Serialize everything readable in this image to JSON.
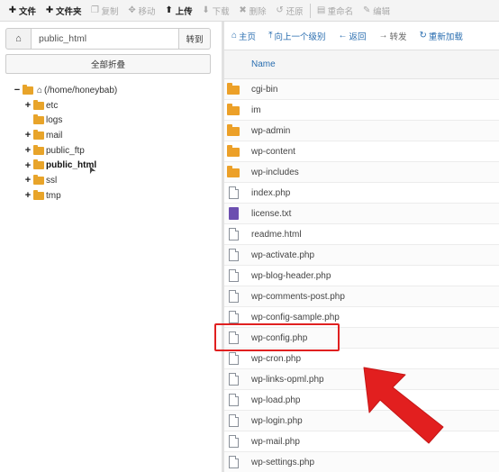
{
  "toolbar": {
    "items": [
      {
        "icon": "plus-icon",
        "glyph": "✚",
        "label": "文件",
        "enabled": true
      },
      {
        "icon": "plus-icon",
        "glyph": "✚",
        "label": "文件夹",
        "enabled": true
      },
      {
        "icon": "copy-icon",
        "glyph": "❐",
        "label": "复制",
        "enabled": false
      },
      {
        "icon": "move-icon",
        "glyph": "✥",
        "label": "移动",
        "enabled": false
      },
      {
        "icon": "upload-icon",
        "glyph": "⬆",
        "label": "上传",
        "enabled": true
      },
      {
        "icon": "download-icon",
        "glyph": "⬇",
        "label": "下载",
        "enabled": false
      },
      {
        "icon": "delete-icon",
        "glyph": "✖",
        "label": "删除",
        "enabled": false
      },
      {
        "icon": "restore-icon",
        "glyph": "↺",
        "label": "还原",
        "enabled": false
      },
      {
        "icon": "rename-icon",
        "glyph": "▤",
        "label": "重命名",
        "enabled": false
      },
      {
        "icon": "edit-icon",
        "glyph": "✎",
        "label": "编辑",
        "enabled": false
      }
    ]
  },
  "left_panel": {
    "path_value": "public_html",
    "go_label": "转到",
    "collapse_label": "全部折叠",
    "tree": {
      "root_label": "(/home/honeybab)",
      "children": [
        {
          "label": "etc",
          "expandable": true,
          "bold": false
        },
        {
          "label": "logs",
          "expandable": false,
          "bold": false
        },
        {
          "label": "mail",
          "expandable": true,
          "bold": false
        },
        {
          "label": "public_ftp",
          "expandable": true,
          "bold": false
        },
        {
          "label": "public_html",
          "expandable": true,
          "bold": true
        },
        {
          "label": "ssl",
          "expandable": true,
          "bold": false
        },
        {
          "label": "tmp",
          "expandable": true,
          "bold": false
        }
      ]
    }
  },
  "right_panel": {
    "nav": [
      {
        "icon": "home-icon",
        "glyph": "⌂",
        "label": "主页",
        "style": "link"
      },
      {
        "icon": "level-up-icon",
        "glyph": "⤒",
        "label": "向上一个级别",
        "style": "link"
      },
      {
        "icon": "back-icon",
        "glyph": "←",
        "label": "返回",
        "style": "link"
      },
      {
        "icon": "forward-icon",
        "glyph": "→",
        "label": "转发",
        "style": "gray"
      },
      {
        "icon": "reload-icon",
        "glyph": "↻",
        "label": "重新加载",
        "style": "link"
      }
    ],
    "column_name": "Name",
    "files": [
      {
        "name": "cgi-bin",
        "type": "folder"
      },
      {
        "name": "im",
        "type": "folder"
      },
      {
        "name": "wp-admin",
        "type": "folder"
      },
      {
        "name": "wp-content",
        "type": "folder"
      },
      {
        "name": "wp-includes",
        "type": "folder"
      },
      {
        "name": "index.php",
        "type": "php"
      },
      {
        "name": "license.txt",
        "type": "txt"
      },
      {
        "name": "readme.html",
        "type": "php"
      },
      {
        "name": "wp-activate.php",
        "type": "php"
      },
      {
        "name": "wp-blog-header.php",
        "type": "php"
      },
      {
        "name": "wp-comments-post.php",
        "type": "php"
      },
      {
        "name": "wp-config-sample.php",
        "type": "php"
      },
      {
        "name": "wp-config.php",
        "type": "php",
        "highlighted": true
      },
      {
        "name": "wp-cron.php",
        "type": "php"
      },
      {
        "name": "wp-links-opml.php",
        "type": "php"
      },
      {
        "name": "wp-load.php",
        "type": "php"
      },
      {
        "name": "wp-login.php",
        "type": "php"
      },
      {
        "name": "wp-mail.php",
        "type": "php"
      },
      {
        "name": "wp-settings.php",
        "type": "php"
      }
    ]
  },
  "colors": {
    "link": "#2a6eb0",
    "folder": "#eca028",
    "highlight": "#e02020",
    "arrow": "#e21f1f"
  }
}
